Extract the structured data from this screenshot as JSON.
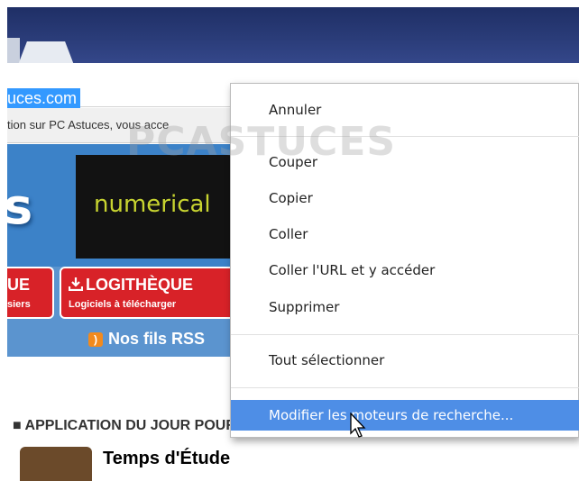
{
  "browser": {
    "address_bar": {
      "url_text": "uces.com"
    }
  },
  "page": {
    "notice_text": "tion sur PC Astuces, vous acce",
    "banner": {
      "logo_letter": "s",
      "ad_text": "numerical"
    },
    "nav": {
      "item1_title": "UE",
      "item1_sub": "siers",
      "item2_title": "LOGITHÈQUE",
      "item2_sub": "Logiciels à télécharger",
      "item2_icon": "download-icon",
      "rss_label": "Nos fils RSS",
      "rss_icon": "rss-icon"
    },
    "app_section": {
      "heading": "■ APPLICATION DU JOUR POUR TÉLÉPHONE & TABLETTE",
      "app_name": "Temps d'Étude"
    },
    "watermark": "PCASTUCES"
  },
  "context_menu": {
    "items": [
      {
        "label": "Annuler"
      },
      {
        "label": "Couper"
      },
      {
        "label": "Copier"
      },
      {
        "label": "Coller"
      },
      {
        "label": "Coller l'URL et y accéder"
      },
      {
        "label": "Supprimer"
      },
      {
        "label": "Tout sélectionner"
      },
      {
        "label": "Modifier les moteurs de recherche..."
      }
    ],
    "highlight_color": "#4e8ee6"
  }
}
